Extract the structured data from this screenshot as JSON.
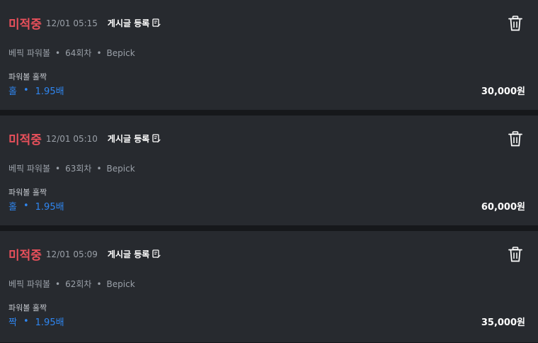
{
  "post_label": "게시글 등록",
  "separator": "•",
  "icons": {
    "edit": "edit-note-icon",
    "delete": "trash-icon"
  },
  "colors": {
    "status": "#e8505b",
    "pick": "#2f86f0",
    "card_bg": "#272a2f",
    "page_bg": "#16181b"
  },
  "bets": [
    {
      "status": "미적중",
      "time": "12/01 05:15",
      "game": "베픽 파워볼",
      "round": "64회차",
      "site": "Bepick",
      "market": "파워볼 홀짝",
      "pick": "홀",
      "odds": "1.95배",
      "amount": "30,000원"
    },
    {
      "status": "미적중",
      "time": "12/01 05:10",
      "game": "베픽 파워볼",
      "round": "63회차",
      "site": "Bepick",
      "market": "파워볼 홀짝",
      "pick": "홀",
      "odds": "1.95배",
      "amount": "60,000원"
    },
    {
      "status": "미적중",
      "time": "12/01 05:09",
      "game": "베픽 파워볼",
      "round": "62회차",
      "site": "Bepick",
      "market": "파워볼 홀짝",
      "pick": "짝",
      "odds": "1.95배",
      "amount": "35,000원"
    }
  ]
}
